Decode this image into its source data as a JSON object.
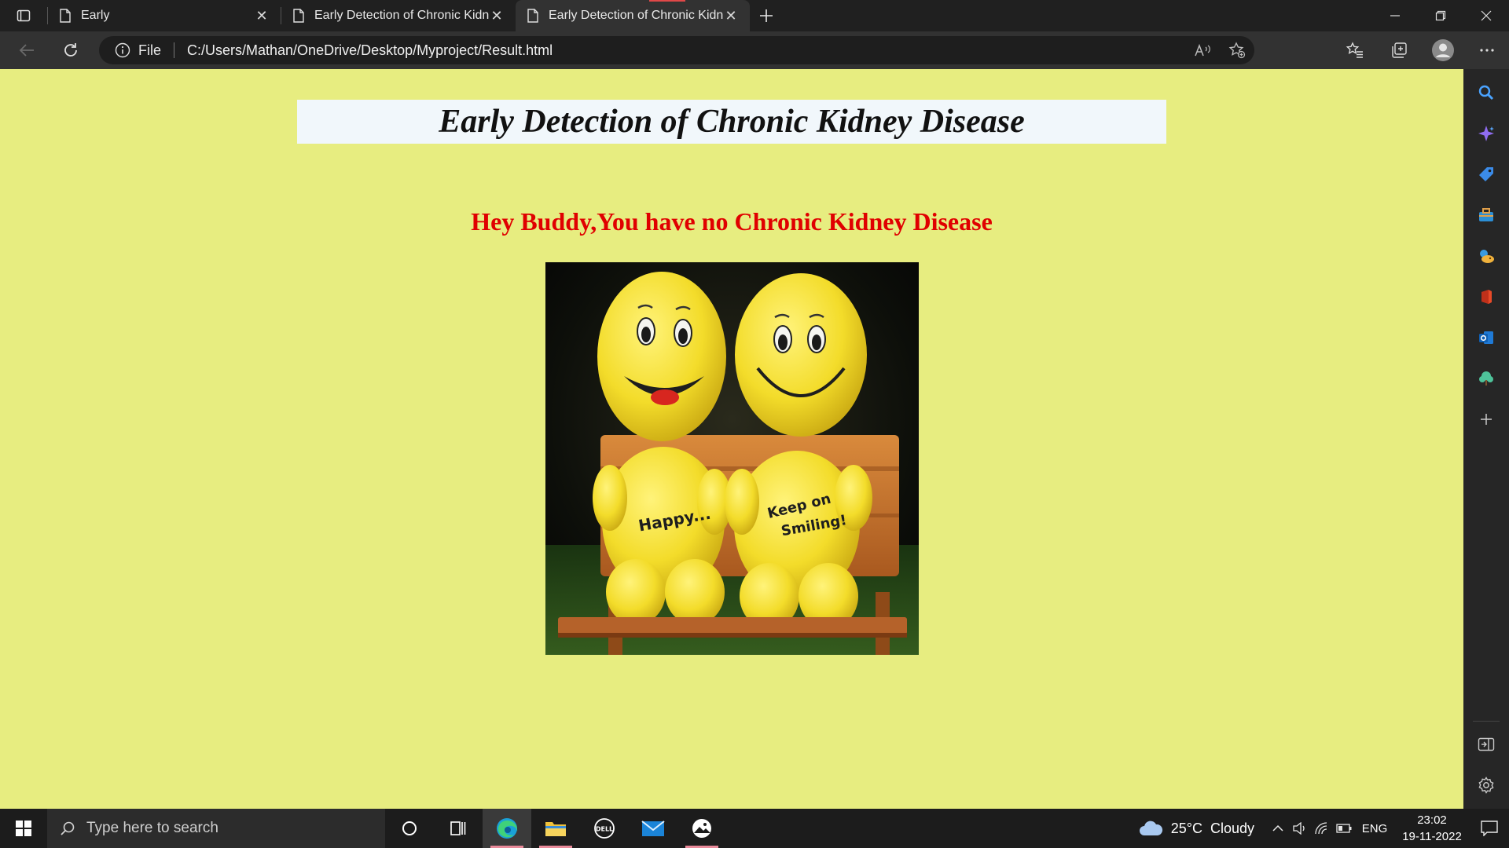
{
  "browser": {
    "tabs": [
      {
        "title": "Early"
      },
      {
        "title": "Early Detection of Chronic Kidney Disease"
      },
      {
        "title": "Early Detection of Chronic Kidney Disease"
      }
    ],
    "address": {
      "scheme_label": "File",
      "url": "C:/Users/Mathan/OneDrive/Desktop/Myproject/Result.html"
    }
  },
  "page": {
    "heading": "Early Detection of Chronic Kidney Disease",
    "result_message": "Hey Buddy,You have no Chronic Kidney Disease",
    "image": {
      "text_left": "Happy...",
      "text_right_line1": "Keep on",
      "text_right_line2": "Smiling!"
    },
    "colors": {
      "background": "#e7ed80",
      "header_bg": "#f1f7fb",
      "message": "#e00000"
    }
  },
  "taskbar": {
    "search_placeholder": "Type here to search",
    "weather_temp": "25°C",
    "weather_condition": "Cloudy",
    "language": "ENG",
    "time": "23:02",
    "date": "19-11-2022"
  }
}
